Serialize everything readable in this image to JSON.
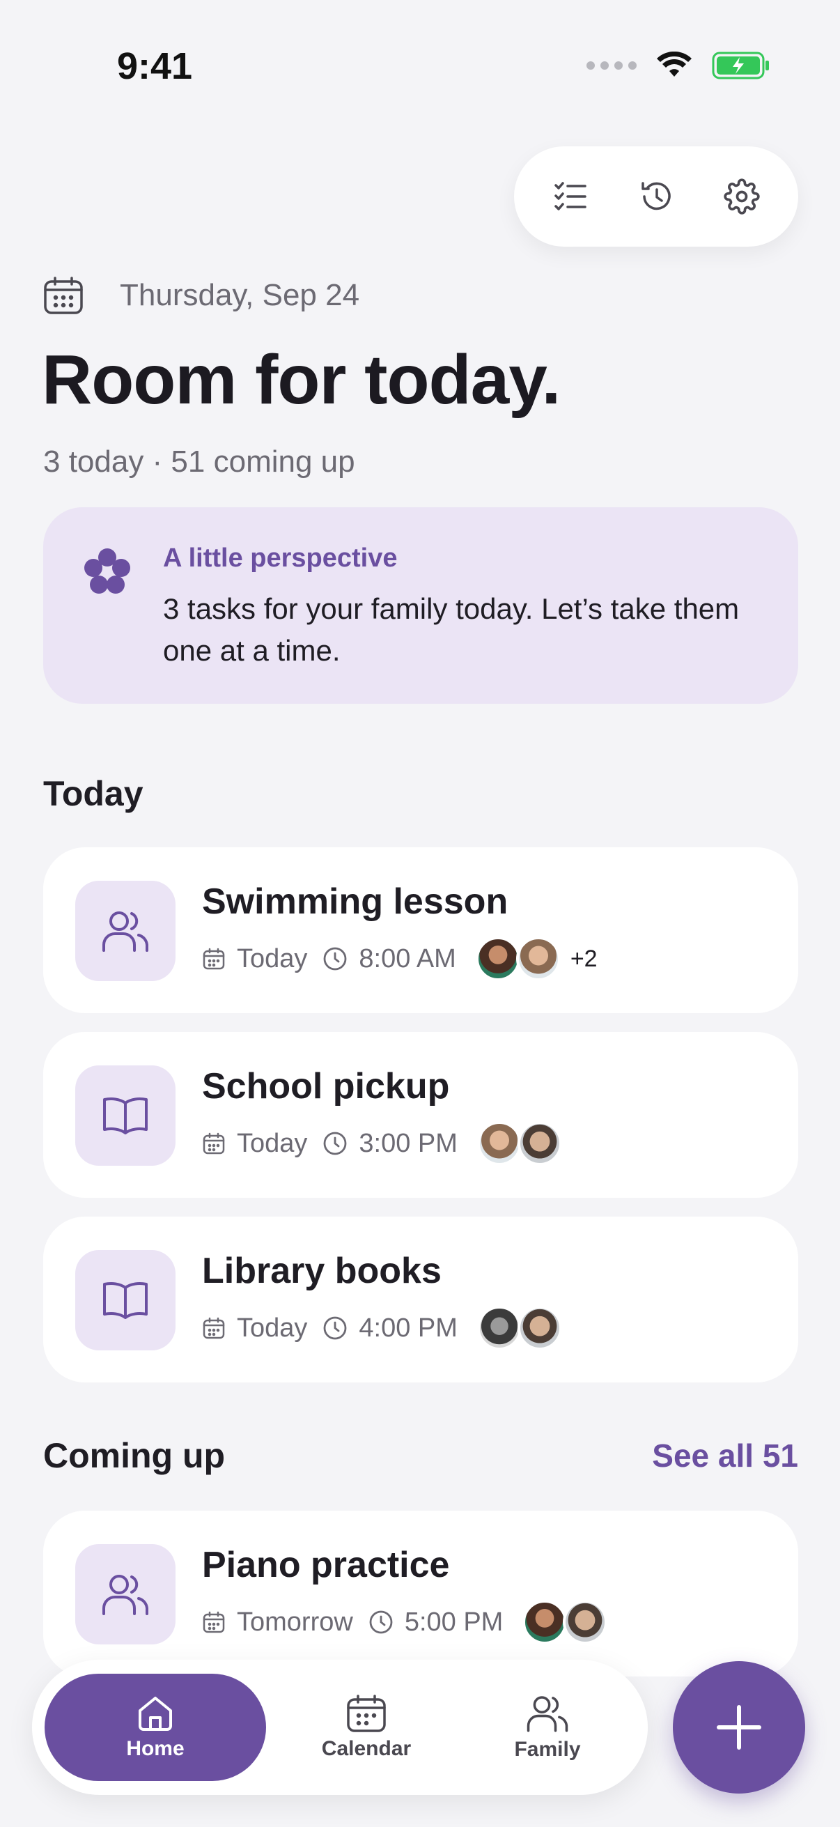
{
  "status_bar": {
    "time": "9:41"
  },
  "header": {
    "date": "Thursday, Sep 24",
    "title": "Room for today.",
    "summary": "3 today · 51 coming up"
  },
  "perspective": {
    "title": "A little perspective",
    "body": "3 tasks for your family today. Let’s take them one at a time."
  },
  "sections": {
    "today": "Today",
    "coming_up": "Coming up",
    "see_all": "See all 51"
  },
  "tasks_today": [
    {
      "title": "Swimming lesson",
      "day": "Today",
      "time": "8:00 AM",
      "icon": "people-icon",
      "extra": "+2"
    },
    {
      "title": "School pickup",
      "day": "Today",
      "time": "3:00 PM",
      "icon": "book-icon"
    },
    {
      "title": "Library books",
      "day": "Today",
      "time": "4:00 PM",
      "icon": "book-icon"
    }
  ],
  "tasks_upcoming": [
    {
      "title": "Piano practice",
      "day": "Tomorrow",
      "time": "5:00 PM",
      "icon": "people-icon"
    }
  ],
  "nav": {
    "home": "Home",
    "calendar": "Calendar",
    "family": "Family"
  },
  "colors": {
    "accent": "#6a4fa0",
    "accent_soft": "#ebe4f5",
    "background": "#f4f4f7"
  }
}
